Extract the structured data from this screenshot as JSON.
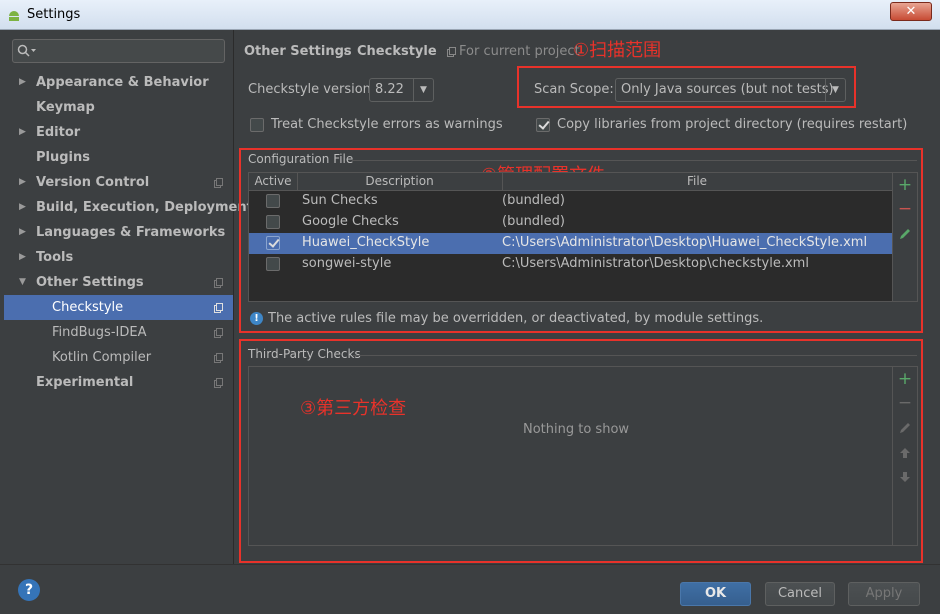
{
  "window": {
    "title": "Settings",
    "close": "✕"
  },
  "search": {
    "placeholder": ""
  },
  "sidebar": {
    "items": [
      {
        "label": "Appearance & Behavior"
      },
      {
        "label": "Keymap"
      },
      {
        "label": "Editor"
      },
      {
        "label": "Plugins"
      },
      {
        "label": "Version Control"
      },
      {
        "label": "Build, Execution, Deployment"
      },
      {
        "label": "Languages & Frameworks"
      },
      {
        "label": "Tools"
      },
      {
        "label": "Other Settings"
      },
      {
        "label": "Checkstyle"
      },
      {
        "label": "FindBugs-IDEA"
      },
      {
        "label": "Kotlin Compiler"
      },
      {
        "label": "Experimental"
      }
    ]
  },
  "breadcrumb": {
    "parent": "Other Settings",
    "sep": "›",
    "current": "Checkstyle",
    "scope_note": "For current project"
  },
  "annotations": {
    "a1": "①扫描范围",
    "a2": "②管理配置文件",
    "a3": "③第三方检查"
  },
  "settings": {
    "version_label": "Checkstyle version:",
    "version_value": "8.22",
    "scan_label": "Scan Scope:",
    "scan_value": "Only Java sources (but not tests)",
    "treat_errors": "Treat Checkstyle errors as warnings",
    "copy_libs": "Copy libraries from project directory (requires restart)"
  },
  "config": {
    "title": "Configuration File",
    "headers": {
      "active": "Active",
      "description": "Description",
      "file": "File"
    },
    "rows": [
      {
        "active": false,
        "description": "Sun Checks",
        "file": "(bundled)"
      },
      {
        "active": false,
        "description": "Google Checks",
        "file": "(bundled)"
      },
      {
        "active": true,
        "description": "Huawei_CheckStyle",
        "file": "C:\\Users\\Administrator\\Desktop\\Huawei_CheckStyle.xml"
      },
      {
        "active": false,
        "description": "songwei-style",
        "file": "C:\\Users\\Administrator\\Desktop\\checkstyle.xml"
      }
    ],
    "info": "The active rules file may be overridden, or deactivated, by module settings."
  },
  "third_party": {
    "title": "Third-Party Checks",
    "empty": "Nothing to show"
  },
  "footer": {
    "help": "?",
    "ok": "OK",
    "cancel": "Cancel",
    "apply": "Apply"
  },
  "colors": {
    "accent": "#4b6eaf",
    "annotation": "#e8322a",
    "add": "#59a869",
    "remove": "#c75450"
  }
}
